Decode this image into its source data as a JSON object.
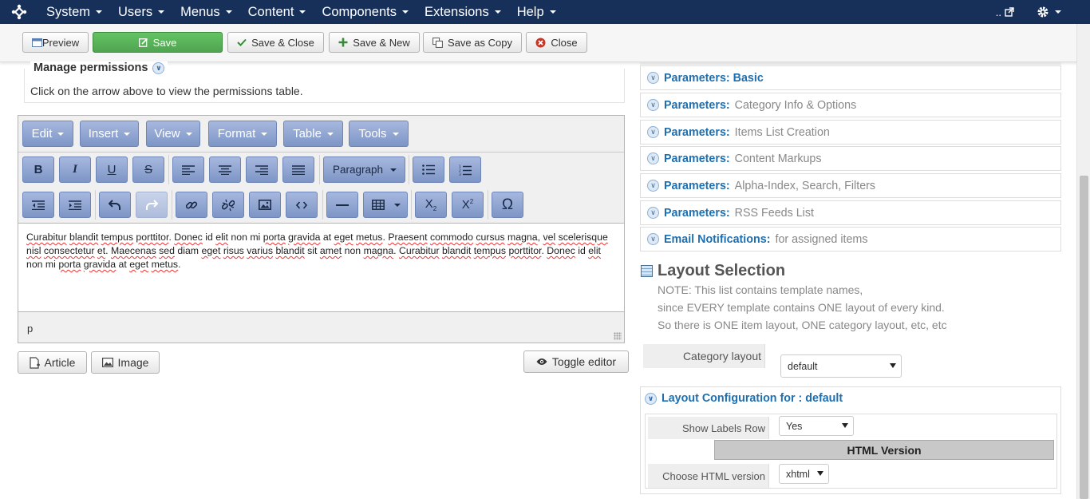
{
  "navbar": {
    "logo": "joomla-logo",
    "menu": [
      "System",
      "Users",
      "Menus",
      "Content",
      "Components",
      "Extensions",
      "Help"
    ],
    "site_link": "..",
    "bg": "#17305a"
  },
  "toolbar": {
    "preview": "Preview",
    "save": "Save",
    "save_close": "Save & Close",
    "save_new": "Save & New",
    "save_copy": "Save as Copy",
    "close": "Close"
  },
  "permissions": {
    "title": "Manage permissions",
    "hint": "Click on the arrow above to view the permissions table."
  },
  "editor": {
    "menubar": [
      "Edit",
      "Insert",
      "View",
      "Format",
      "Table",
      "Tools"
    ],
    "block_format": "Paragraph",
    "content_words": [
      [
        "Curabitur",
        true
      ],
      [
        " ",
        false
      ],
      [
        "blandit",
        true
      ],
      [
        " ",
        false
      ],
      [
        "tempus",
        true
      ],
      [
        " ",
        false
      ],
      [
        "porttitor",
        true
      ],
      [
        ". ",
        false
      ],
      [
        "Donec",
        true
      ],
      [
        " id ",
        false
      ],
      [
        "elit",
        true
      ],
      [
        " non mi ",
        false
      ],
      [
        "porta",
        true
      ],
      [
        " ",
        false
      ],
      [
        "gravida",
        true
      ],
      [
        " at ",
        false
      ],
      [
        "eget",
        true
      ],
      [
        " ",
        false
      ],
      [
        "metus",
        true
      ],
      [
        ". ",
        false
      ],
      [
        "Praesent",
        true
      ],
      [
        " ",
        false
      ],
      [
        "commodo",
        true
      ],
      [
        " ",
        false
      ],
      [
        "cursus",
        true
      ],
      [
        " ",
        false
      ],
      [
        "magna",
        true
      ],
      [
        ", ",
        false
      ],
      [
        "vel",
        true
      ],
      [
        " ",
        false
      ],
      [
        "scelerisque",
        true
      ],
      [
        " ",
        false
      ],
      [
        "nisl",
        true
      ],
      [
        " ",
        false
      ],
      [
        "consectetur",
        true
      ],
      [
        " ",
        false
      ],
      [
        "et",
        true
      ],
      [
        ". ",
        false
      ],
      [
        "Maecenas",
        true
      ],
      [
        " ",
        false
      ],
      [
        "sed",
        true
      ],
      [
        " diam ",
        false
      ],
      [
        "eget",
        true
      ],
      [
        " ",
        false
      ],
      [
        "risus",
        true
      ],
      [
        " ",
        false
      ],
      [
        "varius",
        true
      ],
      [
        " ",
        false
      ],
      [
        "blandit",
        true
      ],
      [
        " sit ",
        false
      ],
      [
        "amet",
        true
      ],
      [
        " non ",
        false
      ],
      [
        "magna",
        true
      ],
      [
        ". ",
        false
      ],
      [
        "Curabitur",
        true
      ],
      [
        " ",
        false
      ],
      [
        "blandit",
        true
      ],
      [
        " ",
        false
      ],
      [
        "tempus",
        true
      ],
      [
        " ",
        false
      ],
      [
        "porttitor",
        true
      ],
      [
        ". ",
        false
      ],
      [
        "Donec",
        true
      ],
      [
        " id ",
        false
      ],
      [
        "elit",
        true
      ],
      [
        " non mi ",
        false
      ],
      [
        "porta",
        true
      ],
      [
        " ",
        false
      ],
      [
        "gravida",
        true
      ],
      [
        " at ",
        false
      ],
      [
        "eget",
        true
      ],
      [
        " ",
        false
      ],
      [
        "metus",
        true
      ],
      [
        ".",
        false
      ]
    ],
    "status_path": "p",
    "buttons": {
      "article": "Article",
      "image": "Image",
      "toggle": "Toggle editor"
    }
  },
  "params": [
    {
      "key": "Parameters: Basic",
      "value": ""
    },
    {
      "key": "Parameters:",
      "value": "Category Info & Options"
    },
    {
      "key": "Parameters:",
      "value": "Items List Creation"
    },
    {
      "key": "Parameters:",
      "value": "Content Markups"
    },
    {
      "key": "Parameters:",
      "value": "Alpha-Index, Search, Filters"
    },
    {
      "key": "Parameters:",
      "value": "RSS Feeds List"
    },
    {
      "key": "Email Notifications:",
      "value": "for assigned items"
    }
  ],
  "layout": {
    "title": "Layout Selection",
    "notes": [
      "NOTE: This list contains template names,",
      "since EVERY template contains ONE layout of every kind.",
      "So there is ONE item layout, ONE category layout, etc, etc"
    ],
    "category_label": "Category layout",
    "category_value": "default",
    "config_title": "Layout Configuration for : default",
    "show_labels_label": "Show Labels Row",
    "show_labels_value": "Yes",
    "html_version_heading": "HTML Version",
    "choose_html_label": "Choose HTML version",
    "choose_html_value": "xhtml"
  }
}
